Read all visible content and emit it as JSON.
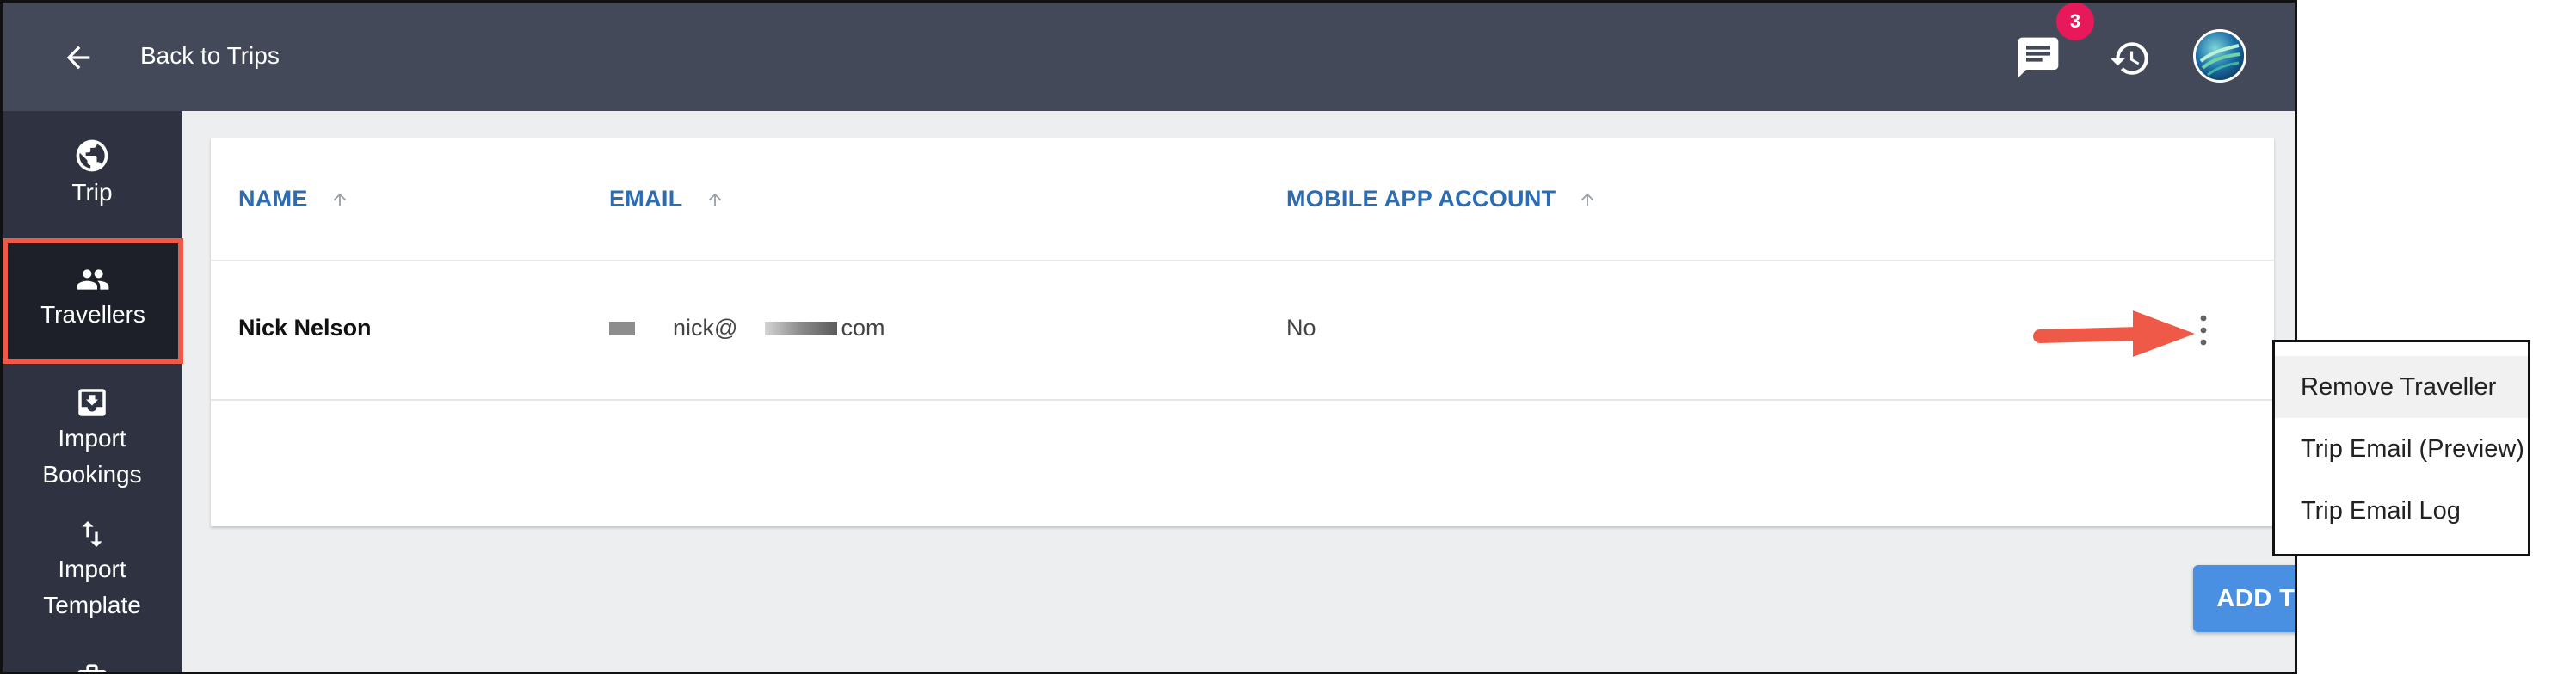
{
  "header": {
    "back_label": "Back to Trips",
    "notification_count": "3"
  },
  "sidebar": {
    "items": [
      {
        "label": "Trip",
        "icon": "globe-icon"
      },
      {
        "label": "Travellers",
        "icon": "people-icon",
        "active": true
      },
      {
        "label": "Import Bookings",
        "line1": "Import",
        "line2": "Bookings",
        "icon": "inbox-download-icon"
      },
      {
        "label": "Import Template",
        "line1": "Import",
        "line2": "Template",
        "icon": "swap-vertical-icon"
      }
    ]
  },
  "table": {
    "columns": [
      "NAME",
      "EMAIL",
      "MOBILE APP ACCOUNT"
    ],
    "rows": [
      {
        "name": "Nick Nelson",
        "email_part1": "nick@",
        "email_part2": "com",
        "mobile_app_account": "No"
      }
    ]
  },
  "actions": {
    "add_traveller": "ADD TRAVELLER"
  },
  "context_menu": {
    "items": [
      "Remove Traveller",
      "Trip Email (Preview)",
      "Trip Email Log"
    ]
  },
  "colors": {
    "topbar": "#434959",
    "sidebar": "#2f3341",
    "accent_blue": "#2b6cb3",
    "button_blue": "#4a90e2",
    "badge": "#e8195a",
    "highlight": "#ee5a47"
  }
}
